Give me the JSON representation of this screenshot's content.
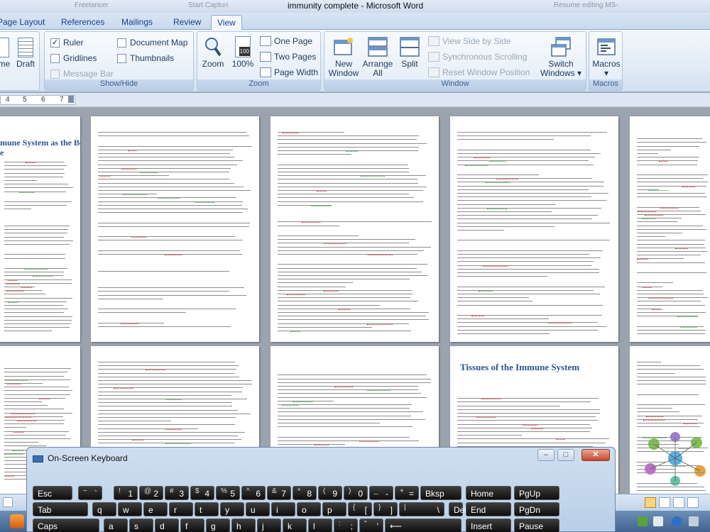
{
  "window": {
    "title": "immunity complete - Microsoft Word",
    "ghost_tabs": [
      "Freelancer",
      "Start Capturi",
      "Resume editing MS-"
    ]
  },
  "tabs": [
    "Page Layout",
    "References",
    "Mailings",
    "Review",
    "View"
  ],
  "active_tab": "View",
  "ribbon": {
    "document_views": {
      "partial_label": "me",
      "draft_label": "Draft"
    },
    "show_hide": {
      "label": "Show/Hide",
      "ruler": "Ruler",
      "gridlines": "Gridlines",
      "message_bar": "Message Bar",
      "document_map": "Document Map",
      "thumbnails": "Thumbnails",
      "ruler_checked": "✓"
    },
    "zoom": {
      "label": "Zoom",
      "zoom_btn": "Zoom",
      "pct_btn": "100%",
      "pct_icon_text": "100",
      "one_page": "One Page",
      "two_pages": "Two Pages",
      "page_width": "Page Width"
    },
    "window": {
      "label": "Window",
      "new_window_1": "New",
      "new_window_2": "Window",
      "arrange_all_1": "Arrange",
      "arrange_all_2": "All",
      "split": "Split",
      "view_side_by_side": "View Side by Side",
      "sync_scrolling": "Synchronous Scrolling",
      "reset_position": "Reset Window Position",
      "switch_1": "Switch",
      "switch_2": "Windows ▾"
    },
    "macros": {
      "label": "Macros",
      "btn_1": "Macros",
      "btn_2": "▾"
    }
  },
  "ruler_numbers": [
    "4",
    "5",
    "6",
    "7"
  ],
  "pages": {
    "page1_heading_1": "mune System as the Body's",
    "page1_heading_2": "e",
    "page9_heading": "Tissues of the Immune System"
  },
  "osk": {
    "title": "On-Screen Keyboard",
    "min": "–",
    "max": "□",
    "close": "✕",
    "rows": [
      [
        {
          "l": "Esc"
        },
        {
          "s": "~",
          "l": "`"
        },
        {
          "s": "!",
          "l": "1"
        },
        {
          "s": "@",
          "l": "2"
        },
        {
          "s": "#",
          "l": "3"
        },
        {
          "s": "$",
          "l": "4"
        },
        {
          "s": "%",
          "l": "5"
        },
        {
          "s": "^",
          "l": "6"
        },
        {
          "s": "&",
          "l": "7"
        },
        {
          "s": "*",
          "l": "8"
        },
        {
          "s": "(",
          "l": "9"
        },
        {
          "s": ")",
          "l": "0"
        },
        {
          "s": "_",
          "l": "-"
        },
        {
          "s": "+",
          "l": "="
        },
        {
          "l": "Bksp"
        },
        {
          "l": "Home"
        },
        {
          "l": "PgUp"
        }
      ],
      [
        {
          "l": "Tab"
        },
        {
          "l": "q"
        },
        {
          "l": "w"
        },
        {
          "l": "e"
        },
        {
          "l": "r"
        },
        {
          "l": "t"
        },
        {
          "l": "y"
        },
        {
          "l": "u"
        },
        {
          "l": "i"
        },
        {
          "l": "o"
        },
        {
          "l": "p"
        },
        {
          "s": "{",
          "l": "["
        },
        {
          "s": "}",
          "l": "]"
        },
        {
          "s": "|",
          "l": "\\"
        },
        {
          "l": "Del"
        },
        {
          "l": "End"
        },
        {
          "l": "PgDn"
        }
      ],
      [
        {
          "l": "Caps"
        },
        {
          "l": "a"
        },
        {
          "l": "s"
        },
        {
          "l": "d"
        },
        {
          "l": "f"
        },
        {
          "l": "g"
        },
        {
          "l": "h"
        },
        {
          "l": "j"
        },
        {
          "l": "k"
        },
        {
          "l": "l"
        },
        {
          "s": ":",
          "l": ";"
        },
        {
          "s": "\"",
          "l": "'"
        },
        {
          "l": "⟵"
        },
        {
          "l": "Insert"
        },
        {
          "l": "Pause"
        }
      ]
    ]
  }
}
